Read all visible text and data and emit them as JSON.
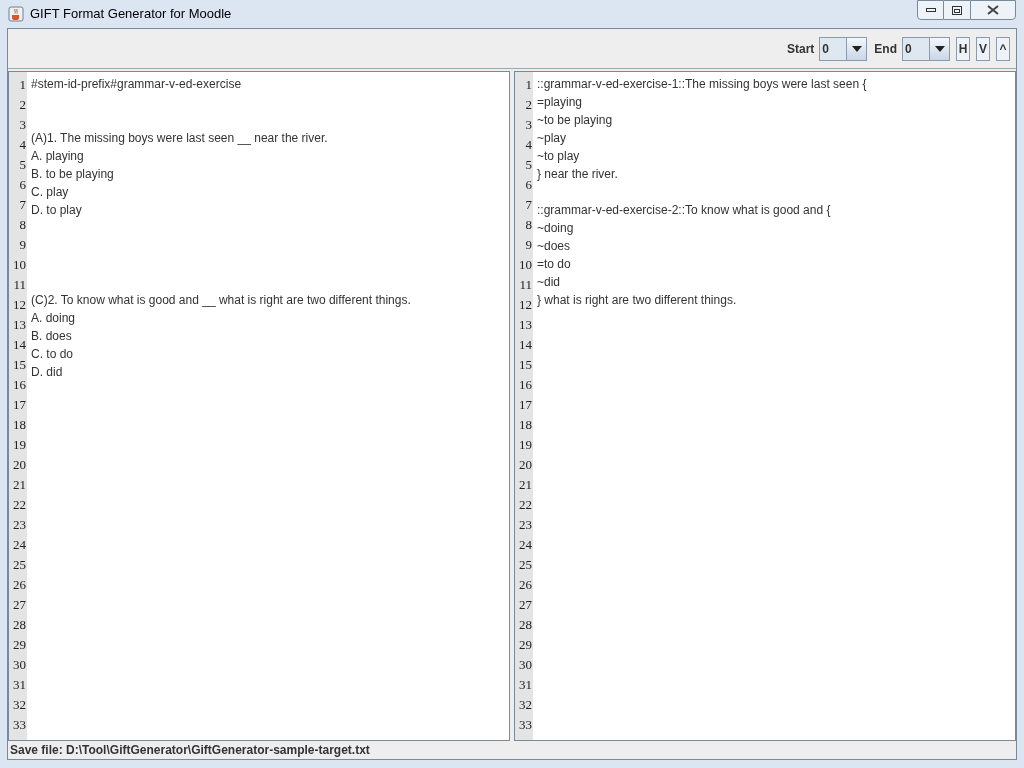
{
  "window": {
    "title": "GIFT Format Generator for Moodle"
  },
  "toolbar": {
    "start_label": "Start",
    "start_value": "0",
    "end_label": "End",
    "end_value": "0",
    "buttons": [
      "H",
      "V",
      "^"
    ]
  },
  "editors": [
    {
      "line_numbers": [
        "1",
        "2",
        "3",
        "4",
        "5",
        "6",
        "7",
        "8",
        "9",
        "10",
        "11",
        "12",
        "13",
        "14",
        "15",
        "16",
        "17",
        "18",
        "19",
        "20",
        "21",
        "22",
        "23",
        "24",
        "25",
        "26",
        "27",
        "28",
        "29",
        "30",
        "31",
        "32",
        "33"
      ],
      "lines": [
        {
          "kind": "text",
          "text": "#stem-id-prefix#grammar-v-ed-exercise"
        },
        {
          "kind": "blank"
        },
        {
          "kind": "blank"
        },
        {
          "kind": "text",
          "text": "(A)1. The missing boys were last seen __ near the river."
        },
        {
          "kind": "text",
          "text": "A. playing"
        },
        {
          "kind": "text",
          "text": "B. to be playing"
        },
        {
          "kind": "text",
          "text": "C. play"
        },
        {
          "kind": "text",
          "text": "D. to play"
        },
        {
          "kind": "blank"
        },
        {
          "kind": "blank"
        },
        {
          "kind": "blank"
        },
        {
          "kind": "blank"
        },
        {
          "kind": "text",
          "text": "(C)2. To know what is good and __ what is right are two different things."
        },
        {
          "kind": "text",
          "text": "A. doing"
        },
        {
          "kind": "text",
          "text": "B. does"
        },
        {
          "kind": "text",
          "text": "C. to do"
        },
        {
          "kind": "text",
          "text": "D. did"
        }
      ]
    },
    {
      "line_numbers": [
        "1",
        "2",
        "3",
        "4",
        "5",
        "6",
        "7",
        "8",
        "9",
        "10",
        "11",
        "12",
        "13",
        "14",
        "15",
        "16",
        "17",
        "18",
        "19",
        "20",
        "21",
        "22",
        "23",
        "24",
        "25",
        "26",
        "27",
        "28",
        "29",
        "30",
        "31",
        "32",
        "33"
      ],
      "lines": [
        {
          "kind": "text",
          "text": "::grammar-v-ed-exercise-1::The missing boys were last seen {"
        },
        {
          "kind": "text",
          "text": "=playing"
        },
        {
          "kind": "text",
          "text": "~to be playing"
        },
        {
          "kind": "text",
          "text": "~play"
        },
        {
          "kind": "text",
          "text": "~to play"
        },
        {
          "kind": "text",
          "text": "} near the river."
        },
        {
          "kind": "blank"
        },
        {
          "kind": "text",
          "text": "::grammar-v-ed-exercise-2::To know what is good and {"
        },
        {
          "kind": "text",
          "text": "~doing"
        },
        {
          "kind": "text",
          "text": "~does"
        },
        {
          "kind": "text",
          "text": "=to do"
        },
        {
          "kind": "text",
          "text": "~did"
        },
        {
          "kind": "text",
          "text": "} what is right are two different things."
        }
      ]
    }
  ],
  "status_bar": "Save file: D:\\Tool\\GiftGenerator\\GiftGenerator-sample-target.txt"
}
